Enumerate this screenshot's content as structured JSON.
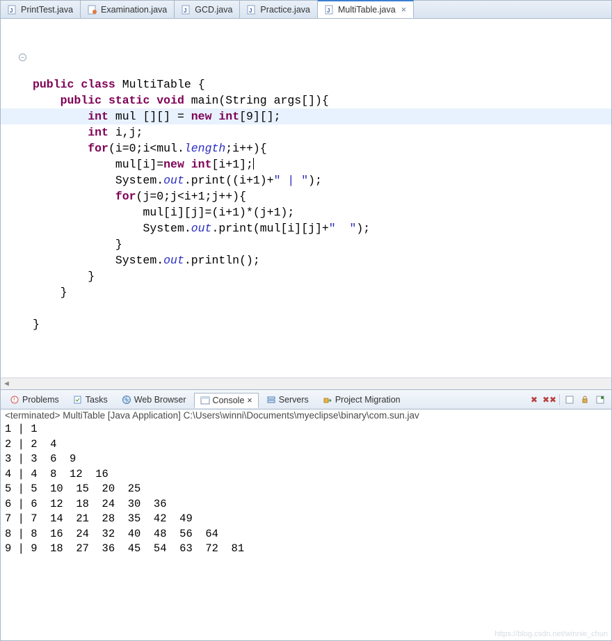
{
  "tabs": [
    {
      "label": "PrintTest.java"
    },
    {
      "label": "Examination.java"
    },
    {
      "label": "GCD.java"
    },
    {
      "label": "Practice.java"
    },
    {
      "label": "MultiTable.java",
      "active": true
    }
  ],
  "code": {
    "kw_public": "public",
    "kw_class": "class",
    "kw_static": "static",
    "kw_void": "void",
    "kw_int": "int",
    "kw_new": "new",
    "kw_for": "for",
    "classname": "MultiTable",
    "main_sig": "main(String args[]){",
    "lbrace": "{",
    "decl_mul": " mul [][] = ",
    "int_arr": "[9][];",
    "decl_ij": " i,j;",
    "for1_a": "(i=0;i<mul.",
    "length": "length",
    "for1_b": ";i++){",
    "mul_assign_a": "mul[i]=",
    "mul_assign_b": "[i+1];",
    "sys": "System.",
    "out": "out",
    "print_a": ".print((i+1)+",
    "str1": "\" | \"",
    "print_b": ");",
    "for2": "(j=0;j<i+1;j++){",
    "calc": "mul[i][j]=(i+1)*(j+1);",
    "print2a": ".print(mul[i][j]+",
    "str2": "\"  \"",
    "print2b": ");",
    "rbrace": "}",
    "println": ".println();"
  },
  "views": [
    {
      "label": "Problems"
    },
    {
      "label": "Tasks"
    },
    {
      "label": "Web Browser"
    },
    {
      "label": "Console",
      "active": true
    },
    {
      "label": "Servers"
    },
    {
      "label": "Project Migration"
    }
  ],
  "console": {
    "header": "<terminated> MultiTable [Java Application] C:\\Users\\winni\\Documents\\myeclipse\\binary\\com.sun.jav",
    "output": "1 | 1  \n2 | 2  4  \n3 | 3  6  9  \n4 | 4  8  12  16  \n5 | 5  10  15  20  25  \n6 | 6  12  18  24  30  36  \n7 | 7  14  21  28  35  42  49  \n8 | 8  16  24  32  40  48  56  64  \n9 | 9  18  27  36  45  54  63  72  81  "
  },
  "watermark": "https://blog.csdn.net/winnie_chun"
}
